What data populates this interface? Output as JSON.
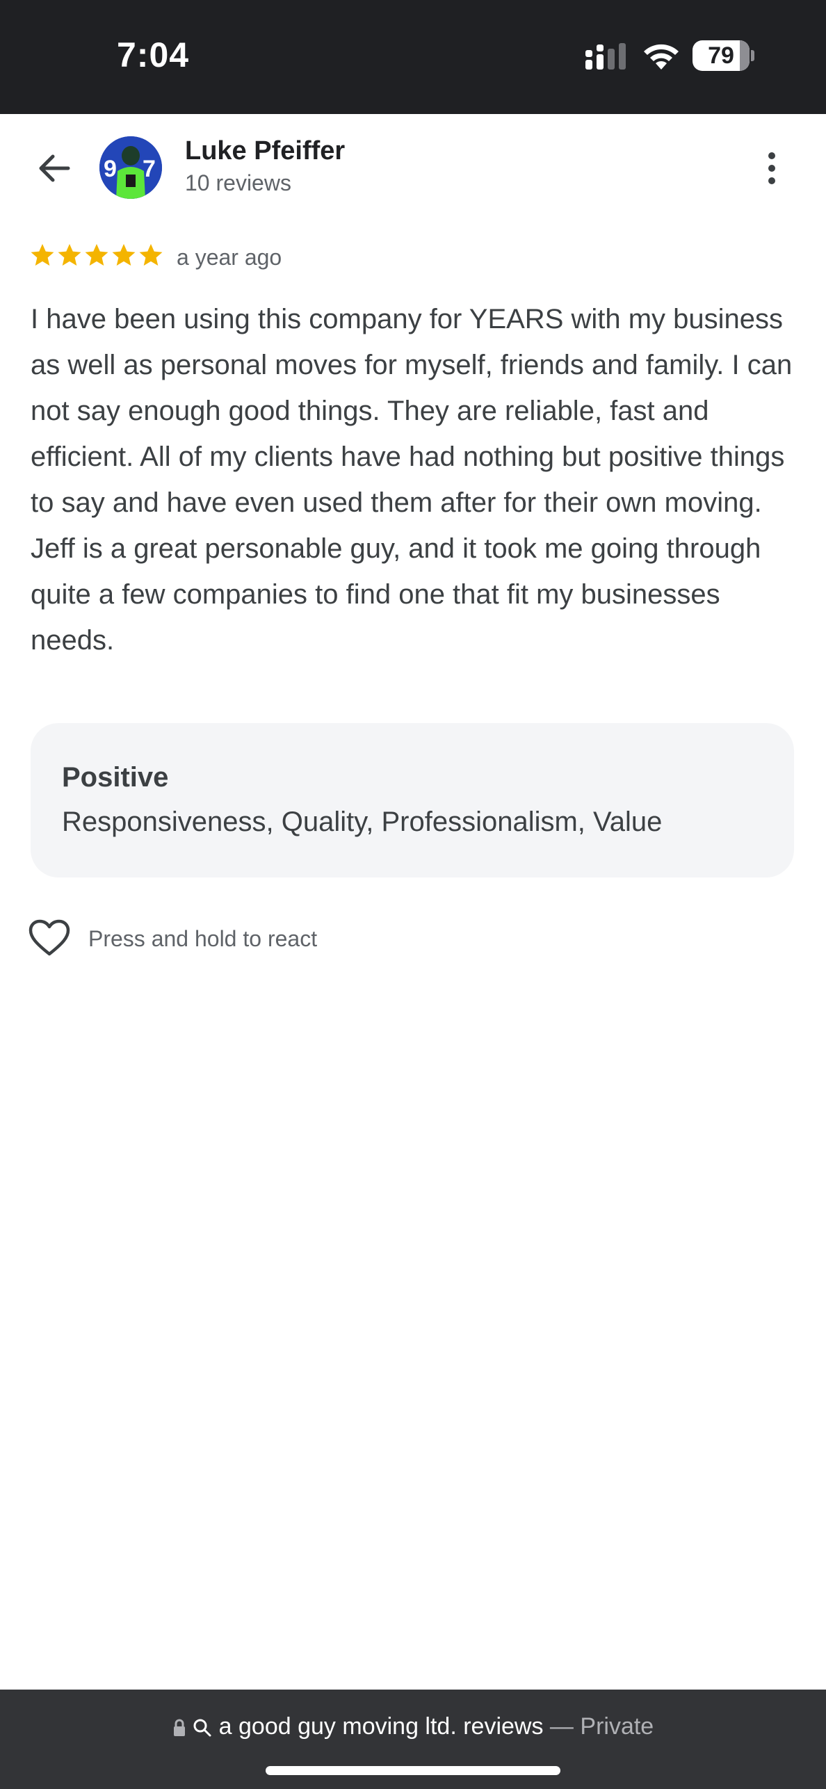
{
  "status_bar": {
    "time": "7:04",
    "battery": "79"
  },
  "header": {
    "name": "Luke Pfeiffer",
    "review_count": "10 reviews"
  },
  "review": {
    "rating": 5,
    "max_rating": 5,
    "star_color": "#f4b400",
    "date": "a year ago",
    "text": "I have been using this company for YEARS with my business as well as personal moves for myself, friends and family. I can not say enough good things. They are reliable, fast and efficient. All of my clients have had nothing but positive things to say and have even used them after for their own moving. Jeff is a great personable guy, and it took me going through quite a few companies to find one that fit my businesses needs."
  },
  "positive": {
    "title": "Positive",
    "values": "Responsiveness, Quality, Professionalism, Value"
  },
  "react": {
    "label": "Press and hold to react"
  },
  "browser_bar": {
    "url_text": "a good guy moving ltd. reviews",
    "separator": " — ",
    "mode": "Private"
  },
  "icons": {
    "back": "back-arrow-icon",
    "more": "more-vert-icon",
    "heart": "heart-outline-icon",
    "lock": "lock-icon",
    "search": "search-icon"
  }
}
